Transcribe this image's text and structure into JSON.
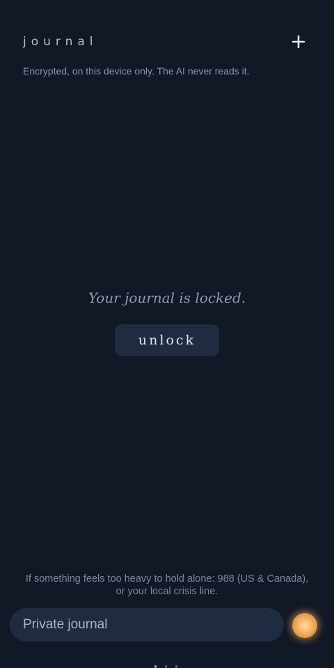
{
  "header": {
    "title": "journal",
    "add_icon": "plus-icon"
  },
  "subtitle": "Encrypted, on this device only. The AI never reads it.",
  "lock_screen": {
    "message": "Your journal is locked.",
    "unlock_label": "unlock"
  },
  "footer": {
    "crisis_line1": "If something feels too heavy to hold alone: 988 (US & Canada),",
    "crisis_line2": "or your local crisis line."
  },
  "composer": {
    "placeholder": "Private journal",
    "value": "",
    "orb_icon": "glowing-orb-icon"
  },
  "colors": {
    "background": "#111826",
    "surface": "#1f2b41",
    "accent": "#f3b062"
  }
}
